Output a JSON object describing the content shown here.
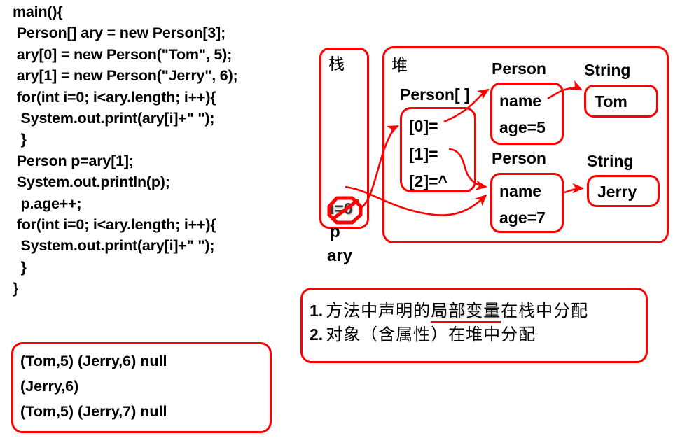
{
  "code": {
    "lines": [
      "main(){",
      " Person[] ary = new Person[3];",
      " ary[0] = new Person(\"Tom\", 5);",
      " ary[1] = new Person(\"Jerry\", 6);",
      " for(int i=0; i<ary.length; i++){",
      "  System.out.print(ary[i]+\" \");",
      "  }",
      " Person p=ary[1];",
      " System.out.println(p);",
      "  p.age++;",
      " for(int i=0; i<ary.length; i++){",
      "  System.out.print(ary[i]+\" \");",
      "  }",
      "}"
    ]
  },
  "console": {
    "lines": [
      "(Tom,5) (Jerry,6) null",
      "(Jerry,6)",
      "(Tom,5) (Jerry,7) null"
    ]
  },
  "memory": {
    "stack": {
      "label": "栈",
      "vars": [
        {
          "name": "i=0",
          "struck": true
        },
        {
          "name": "p",
          "struck": false
        },
        {
          "name": "ary",
          "struck": false
        }
      ]
    },
    "heap": {
      "label": "堆",
      "array": {
        "title": "Person[ ]",
        "slots": [
          "[0]=",
          "[1]=",
          "[2]=^"
        ]
      },
      "objects": [
        {
          "title": "Person",
          "fields": [
            "name",
            "age=5"
          ],
          "string_title": "String",
          "string_value": "Tom"
        },
        {
          "title": "Person",
          "fields": [
            "name",
            "age=7"
          ],
          "string_title": "String",
          "string_value": "Jerry"
        }
      ]
    }
  },
  "notes": {
    "items": [
      {
        "num": "1.",
        "pre": "方法中声明的",
        "highlight": "局部变量",
        "post": "在栈中分配"
      },
      {
        "num": "2.",
        "pre": "对象（含属性）在堆中分配",
        "highlight": "",
        "post": ""
      }
    ]
  },
  "colors": {
    "accent_red": "#ff0000",
    "text_black": "#000000",
    "background": "#ffffff"
  }
}
